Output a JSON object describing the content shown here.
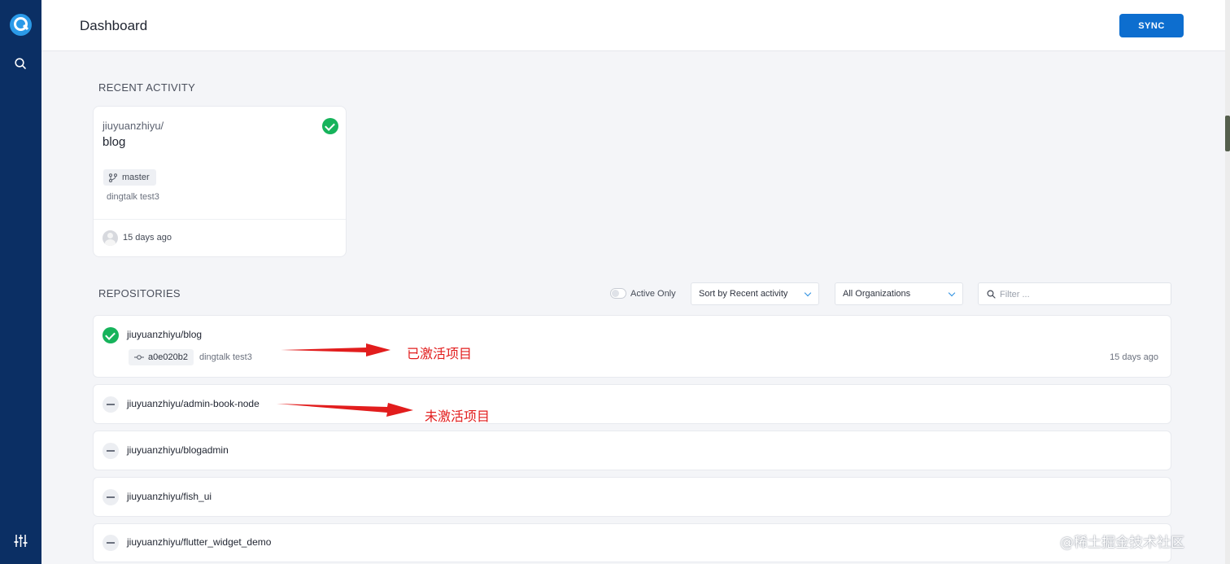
{
  "header": {
    "title": "Dashboard",
    "sync_label": "SYNC"
  },
  "recent": {
    "section_title": "RECENT ACTIVITY",
    "card": {
      "owner": "jiuyuanzhiyu/",
      "repo": "blog",
      "branch": "master",
      "message": "dingtalk test3",
      "time": "15 days ago",
      "status": "success"
    }
  },
  "repositories": {
    "section_title": "REPOSITORIES",
    "active_only_label": "Active Only",
    "active_only": false,
    "sort_value": "Sort by Recent activity",
    "org_value": "All Organizations",
    "filter_placeholder": "Filter ...",
    "items": [
      {
        "name": "jiuyuanzhiyu/blog",
        "active": true,
        "commit": "a0e020b2",
        "message": "dingtalk test3",
        "time": "15 days ago"
      },
      {
        "name": "jiuyuanzhiyu/admin-book-node",
        "active": false
      },
      {
        "name": "jiuyuanzhiyu/blogadmin",
        "active": false
      },
      {
        "name": "jiuyuanzhiyu/fish_ui",
        "active": false
      },
      {
        "name": "jiuyuanzhiyu/flutter_widget_demo",
        "active": false
      }
    ]
  },
  "annotations": {
    "activated": "已激活项目",
    "inactive": "未激活项目"
  },
  "watermark": "@稀土掘金技术社区",
  "colors": {
    "sidebar": "#0b2f64",
    "accent": "#0d6ecf",
    "success": "#16b35b",
    "annotation": "#e21d1d"
  },
  "icons": [
    "logo-icon",
    "search-icon",
    "settings-sliders-icon",
    "check-icon",
    "branch-icon",
    "commit-icon",
    "chevron-down-icon",
    "dash-icon"
  ]
}
